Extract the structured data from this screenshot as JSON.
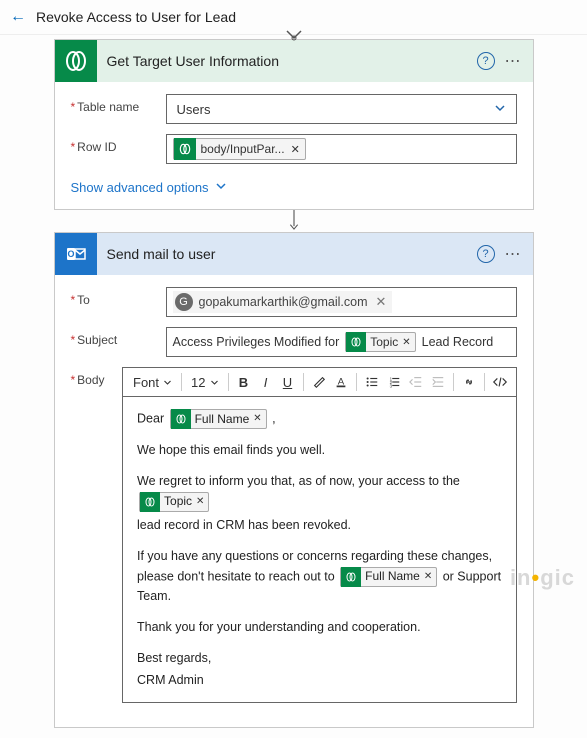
{
  "header": {
    "title": "Revoke Access to User for Lead"
  },
  "card1": {
    "title": "Get Target User Information",
    "tableLabel": "Table name",
    "tableValue": "Users",
    "rowIdLabel": "Row ID",
    "rowIdToken": "body/InputPar...",
    "showAdvanced": "Show advanced options"
  },
  "card2": {
    "title": "Send mail to user",
    "toLabel": "To",
    "toValue": "gopakumarkarthik@gmail.com",
    "toInitial": "G",
    "subjectLabel": "Subject",
    "subjectPrefix": "Access Privileges Modified for",
    "subjectToken": "Topic",
    "subjectSuffix": " Lead Record",
    "bodyLabel": "Body",
    "toolbar": {
      "fontLabel": "Font",
      "sizeLabel": "12"
    },
    "body": {
      "dear": "Dear ",
      "fullNameToken": "Full Name",
      "p1": "We hope this email finds you well.",
      "p2a": "We regret to inform you that, as of now, your access to the ",
      "topicToken": "Topic",
      "p2b": "lead record in CRM has been revoked.",
      "p3a": "If you have any questions or concerns regarding these changes, please don't hesitate to reach out to ",
      "p3b": " or Support Team.",
      "p4": "Thank you for your understanding and cooperation.",
      "sign1": "Best regards,",
      "sign2": "CRM Admin"
    }
  },
  "watermark": "inogic"
}
